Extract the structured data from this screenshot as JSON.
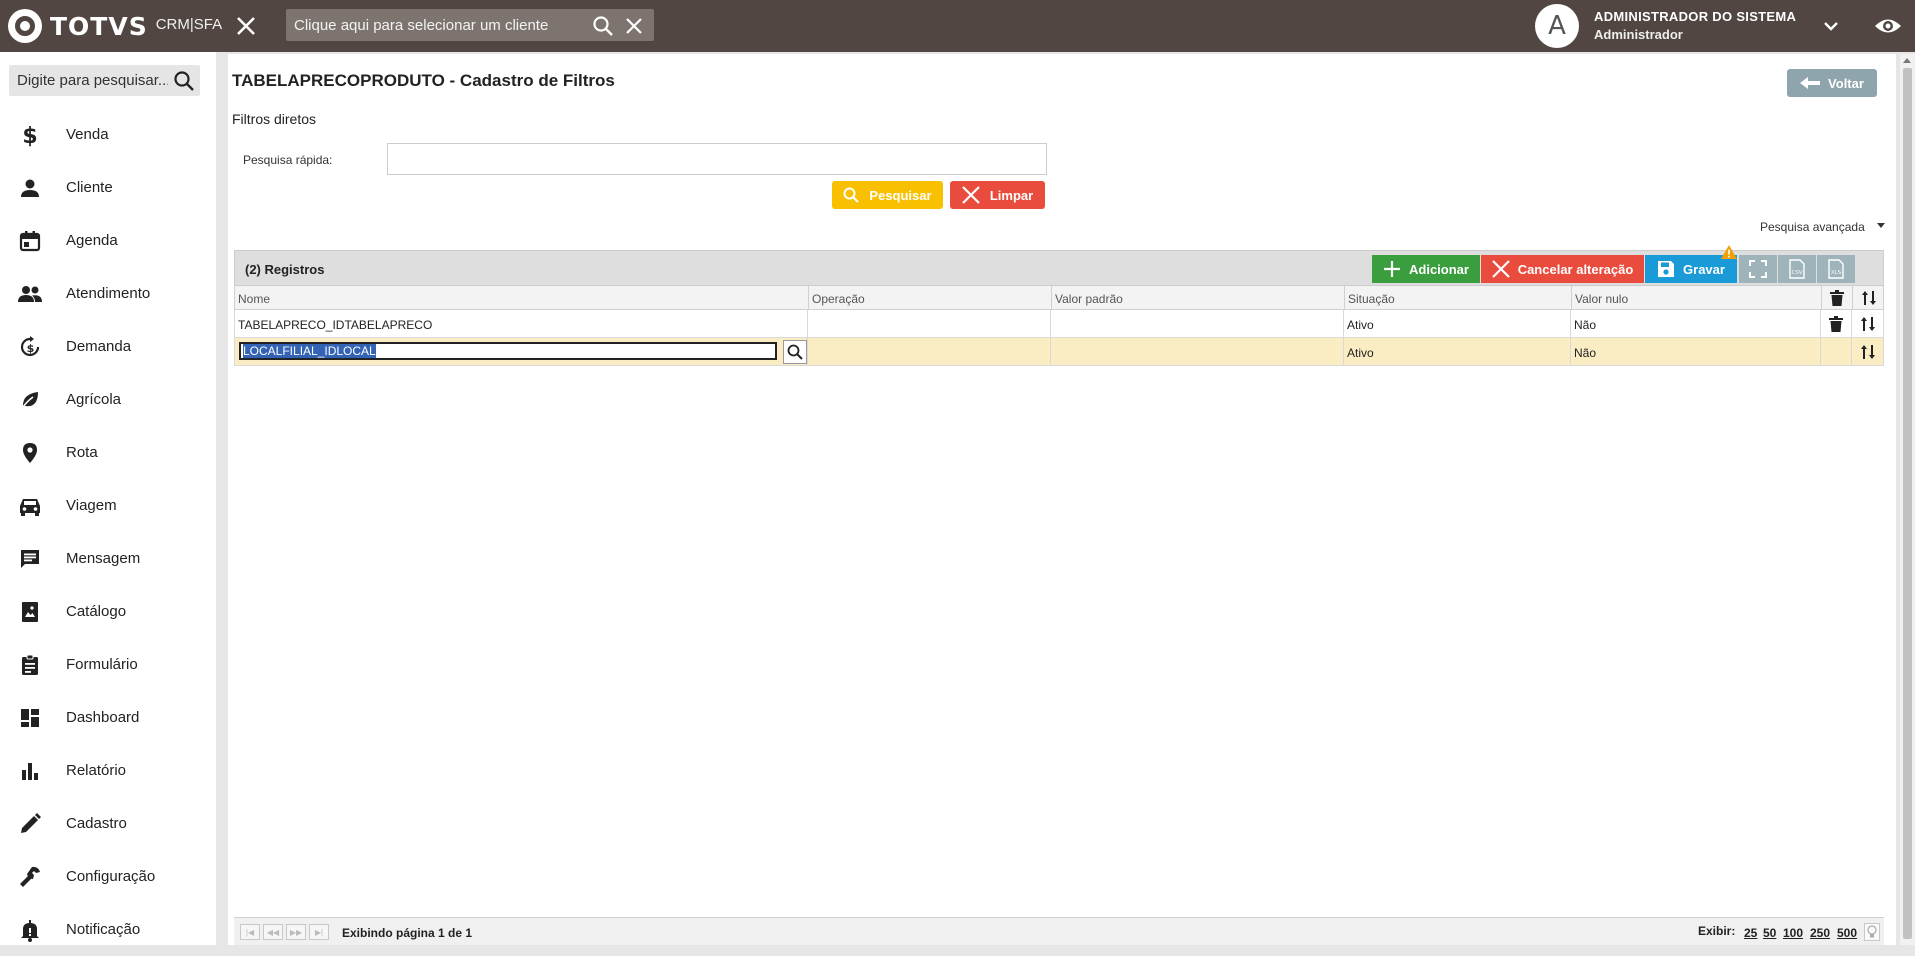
{
  "topbar": {
    "brand": "TOTVS",
    "product": "CRM|SFA",
    "client_search_placeholder": "Clique aqui para selecionar um cliente",
    "avatar_letter": "A",
    "user_name": "ADMINISTRADOR DO SISTEMA",
    "user_role": "Administrador"
  },
  "sidebar": {
    "search_placeholder": "Digite para pesquisar...",
    "items": [
      {
        "label": "Venda",
        "icon": "dollar-icon"
      },
      {
        "label": "Cliente",
        "icon": "person-icon"
      },
      {
        "label": "Agenda",
        "icon": "calendar-icon"
      },
      {
        "label": "Atendimento",
        "icon": "people-icon"
      },
      {
        "label": "Demanda",
        "icon": "money-clock-icon"
      },
      {
        "label": "Agrícola",
        "icon": "leaf-icon"
      },
      {
        "label": "Rota",
        "icon": "location-pin-icon"
      },
      {
        "label": "Viagem",
        "icon": "car-icon"
      },
      {
        "label": "Mensagem",
        "icon": "message-icon"
      },
      {
        "label": "Catálogo",
        "icon": "catalog-icon"
      },
      {
        "label": "Formulário",
        "icon": "clipboard-icon"
      },
      {
        "label": "Dashboard",
        "icon": "dashboard-icon"
      },
      {
        "label": "Relatório",
        "icon": "bar-chart-icon"
      },
      {
        "label": "Cadastro",
        "icon": "pencil-icon"
      },
      {
        "label": "Configuração",
        "icon": "wrench-icon"
      },
      {
        "label": "Notificação",
        "icon": "bell-icon"
      }
    ]
  },
  "main": {
    "title": "TABELAPRECOPRODUTO - Cadastro de Filtros",
    "back_label": "Voltar",
    "filters_heading": "Filtros diretos",
    "quick_search_label": "Pesquisa rápida:",
    "quick_search_value": "",
    "search_button": "Pesquisar",
    "clear_button": "Limpar",
    "advanced_search": "Pesquisa avançada"
  },
  "grid": {
    "record_count": "(2) Registros",
    "add_label": "Adicionar",
    "cancel_label": "Cancelar alteração",
    "save_label": "Gravar",
    "columns": [
      "Nome",
      "Operação",
      "Valor padrão",
      "Situação",
      "Valor nulo"
    ],
    "rows": [
      {
        "nome": "TABELAPRECO_IDTABELAPRECO",
        "operacao": "",
        "valor_padrao": "",
        "situacao": "Ativo",
        "valor_nulo": "Não"
      },
      {
        "nome": "LOCALFILIAL_IDLOCAL",
        "operacao": "",
        "valor_padrao": "",
        "situacao": "Ativo",
        "valor_nulo": "Não"
      }
    ],
    "pager_text": "Exibindo página 1 de 1",
    "show_label": "Exibir:",
    "page_sizes": [
      "25",
      "50",
      "100",
      "250",
      "500"
    ]
  },
  "colors": {
    "topbar": "#514641",
    "add": "#3a9d3e",
    "cancel": "#e94b3c",
    "save": "#1a9bd7",
    "search": "#f9c000",
    "editing_row": "#fbedc3"
  }
}
